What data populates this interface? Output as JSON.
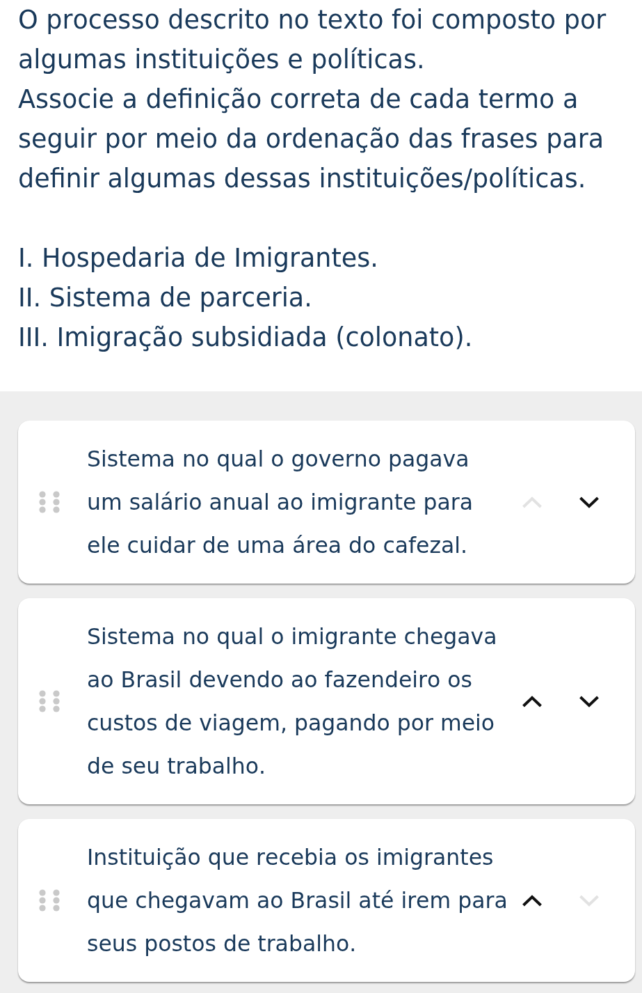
{
  "prompt": [
    "O processo descrito no texto foi composto por algumas instituições e políticas.",
    "Associe a definição correta de cada termo a seguir por meio da ordenação das frases para definir algumas dessas instituições/políticas."
  ],
  "terms": [
    "I. Hospedaria de Imigrantes.",
    "II. Sistema de parceria.",
    "III. Imigração subsidiada (colonato)."
  ],
  "sortable_items": [
    {
      "text": "Sistema no qual o governo pagava um salário anual ao imigrante para ele cuidar de uma área do cafezal.",
      "up_disabled": true,
      "down_disabled": false
    },
    {
      "text": "Sistema no qual o imigrante chegava ao Brasil devendo ao fazendeiro os custos de viagem, pagando por meio de seu trabalho.",
      "up_disabled": false,
      "down_disabled": false
    },
    {
      "text": "Instituição que recebia os imigrantes que chegavam ao Brasil até irem para seus postos de trabalho.",
      "up_disabled": false,
      "down_disabled": true
    }
  ]
}
